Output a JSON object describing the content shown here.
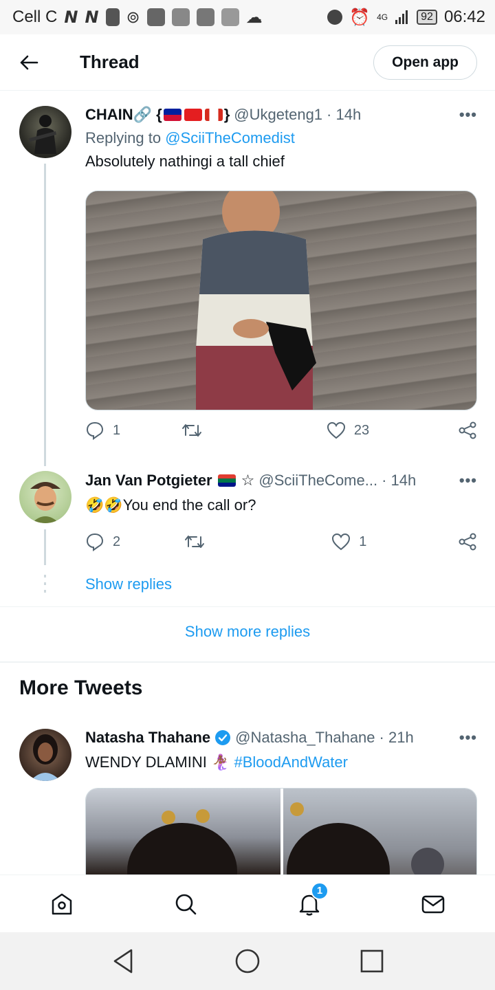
{
  "status_bar": {
    "carrier": "Cell C",
    "network": "4G",
    "battery": "92",
    "time": "06:42"
  },
  "header": {
    "back_icon": "arrow-left-icon",
    "title": "Thread",
    "open_app_label": "Open app"
  },
  "tweets": [
    {
      "name": "CHAIN🔗 {",
      "flags_close": "}",
      "handle": "@Ukgeteng1",
      "time": "· 14h",
      "reply_prefix": "Replying to",
      "reply_to": "@SciiTheComedist",
      "text": "Absolutely nathingi a tall chief",
      "replies": "1",
      "retweets": "",
      "likes": "23"
    },
    {
      "name": "Jan Van Potgieter",
      "badge": "☆",
      "handle": "@SciiTheCome...",
      "time": "· 14h",
      "text": "🤣🤣You end the call or?",
      "replies": "2",
      "retweets": "",
      "likes": "1",
      "show_replies": "Show replies"
    }
  ],
  "show_more_replies": "Show more replies",
  "more_tweets": {
    "title": "More Tweets",
    "tweet": {
      "name": "Natasha Thahane",
      "handle": "@Natasha_Thahane",
      "time": "· 21h",
      "text": "WENDY DLAMINI 🧜🏾‍♀️",
      "hashtag": "#BloodAndWater"
    }
  },
  "bottom_nav": {
    "items": [
      "home-icon",
      "search-icon",
      "notifications-icon",
      "messages-icon"
    ],
    "notification_count": "1"
  },
  "colors": {
    "accent": "#1d9bf0",
    "text_primary": "#0f1419",
    "text_secondary": "#536471",
    "border": "#cfd9de"
  }
}
